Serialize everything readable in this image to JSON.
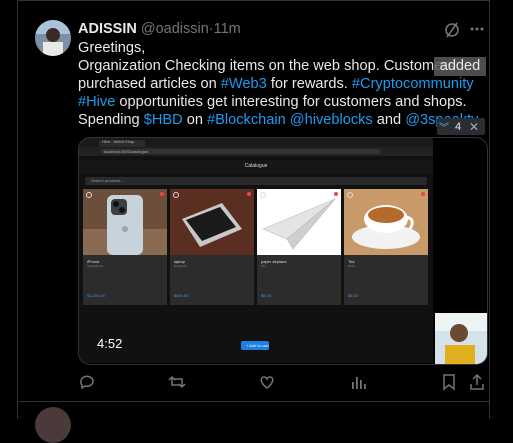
{
  "tweet": {
    "author_name": "ADISSIN",
    "handle": "@oadissin",
    "separator": "·",
    "time": "11m",
    "text": {
      "line1": "Greetings,",
      "line2": "Organization Checking items on the web shop. Customers",
      "line3_pre": "purchased articles on ",
      "line3_link": "#Web3",
      "line3_post": " for rewards. ",
      "line3_link2": "#Cryptocommunity",
      "line4_link": "#Hive",
      "line4_post": " opportunities get interesting for customers and shops.",
      "line5_pre": "Spending ",
      "line5_link1": "$HBD",
      "line5_mid1": " on ",
      "line5_link2": "#Blockchain",
      "line5_mid2": " ",
      "line5_link3": "@hiveblocks",
      "line5_mid3": " and ",
      "line5_link4": "@3speaktv"
    },
    "overlay_word": "added",
    "chip_count": "4",
    "media": {
      "video_time": "4:52",
      "browser_tab": "Hive · Web3 Shop",
      "url": "localhost:3000/catalogue",
      "app_title": "Catalogue",
      "search_placeholder": "Search products...",
      "cart_button": "+ Add to cart",
      "cards": [
        {
          "title": "iPhone",
          "sub": "Smartphone",
          "price": "$1,200.00"
        },
        {
          "title": "laptop",
          "sub": "Notebook",
          "price": "$600.00"
        },
        {
          "title": "paper airplane",
          "sub": "Toy",
          "price": "$5.00"
        },
        {
          "title": "Tea",
          "sub": "Drink",
          "price": "$5.00"
        }
      ]
    }
  },
  "next_tweet": {
    "name": "",
    "handle": ""
  },
  "colors": {
    "accent": "#1d9bf0",
    "background": "#000000",
    "muted": "#71767b",
    "border": "#2f3336"
  },
  "icons": [
    "reply-icon",
    "retweet-icon",
    "like-icon",
    "views-icon",
    "bookmark-icon",
    "share-icon",
    "grok-icon",
    "more-icon"
  ]
}
